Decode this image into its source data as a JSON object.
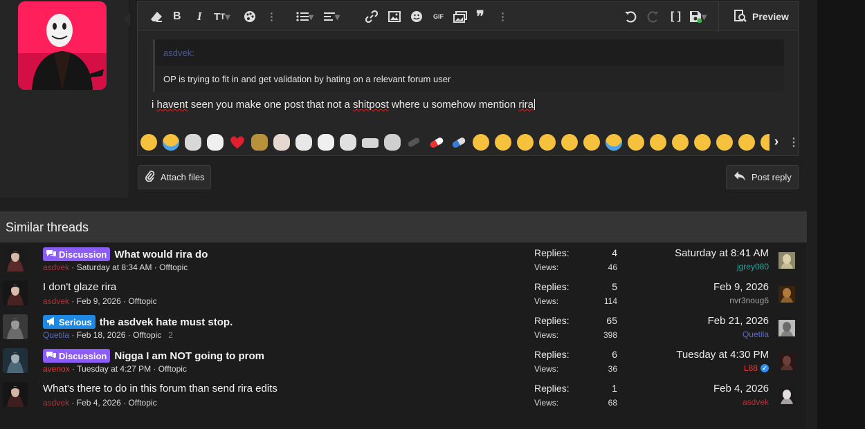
{
  "editor": {
    "toolbar": {
      "icons": [
        "eraser-icon",
        "bold-icon",
        "italic-icon",
        "text-size-icon",
        "palette-icon",
        "more-icon",
        "list-icon",
        "align-icon",
        "link-icon",
        "image-icon",
        "smilie-icon",
        "gif-icon",
        "media-icon",
        "quote-icon",
        "more-icon",
        "undo-icon",
        "redo-icon",
        "bbcode-icon",
        "drafts-icon"
      ],
      "gif_label": "GIF",
      "preview_label": "Preview"
    },
    "quote": {
      "author": "asdvek:",
      "body": "OP is trying to fit in and get validation by hating on a relevant forum user"
    },
    "typed": {
      "p1": "i ",
      "w1": "havent",
      "p2": " seen you make one post that not a ",
      "w2": "shitpost",
      "p3": " where u somehow mention ",
      "w3": "rira"
    }
  },
  "buttons": {
    "attach": "Attach files",
    "post": "Post reply"
  },
  "similar": {
    "heading": "Similar threads",
    "replies_label": "Replies:",
    "views_label": "Views:",
    "threads": [
      {
        "prefix": "Discussion",
        "prefix_color": "#8b5cf6",
        "title": "What would rira do",
        "bold": true,
        "author": "asdvek",
        "author_color": "#b2323c",
        "date": "Saturday at 8:34 AM",
        "forum": "Offtopic",
        "pages": "",
        "replies": "4",
        "views": "46",
        "last_date": "Saturday at 8:41 AM",
        "last_user": "jgrey080",
        "last_user_color": "#26a69a",
        "verified": false
      },
      {
        "prefix": "",
        "prefix_color": "",
        "title": "I don't glaze rira",
        "bold": false,
        "author": "asdvek",
        "author_color": "#b2323c",
        "date": "Feb 9, 2026",
        "forum": "Offtopic",
        "pages": "",
        "replies": "5",
        "views": "114",
        "last_date": "Feb 9, 2026",
        "last_user": "nvr3noug6",
        "last_user_color": "#a0a0a0",
        "verified": false
      },
      {
        "prefix": "Serious",
        "prefix_color": "#1e88e5",
        "title": "the asdvek hate must stop.",
        "bold": true,
        "author": "Quetila",
        "author_color": "#5c6bc0",
        "date": "Feb 18, 2026",
        "forum": "Offtopic",
        "pages": "2",
        "replies": "65",
        "views": "398",
        "last_date": "Feb 21, 2026",
        "last_user": "Quetila",
        "last_user_color": "#5c6bc0",
        "verified": false
      },
      {
        "prefix": "Discussion",
        "prefix_color": "#8b5cf6",
        "title": "Nigga I am NOT going to prom",
        "bold": true,
        "author": "avenox",
        "author_color": "#e53935",
        "date": "Tuesday at 4:27 PM",
        "forum": "Offtopic",
        "pages": "",
        "replies": "6",
        "views": "36",
        "last_date": "Tuesday at 4:30 PM",
        "last_user": "L88",
        "last_user_color": "#e53935",
        "verified": true
      },
      {
        "prefix": "",
        "prefix_color": "",
        "title": "What's there to do in this forum than send rira edits",
        "bold": false,
        "author": "asdvek",
        "author_color": "#b2323c",
        "date": "Feb 4, 2026",
        "forum": "Offtopic",
        "pages": "",
        "replies": "1",
        "views": "68",
        "last_date": "Feb 4, 2026",
        "last_user": "asdvek",
        "last_user_color": "#b2323c",
        "verified": false
      }
    ]
  }
}
